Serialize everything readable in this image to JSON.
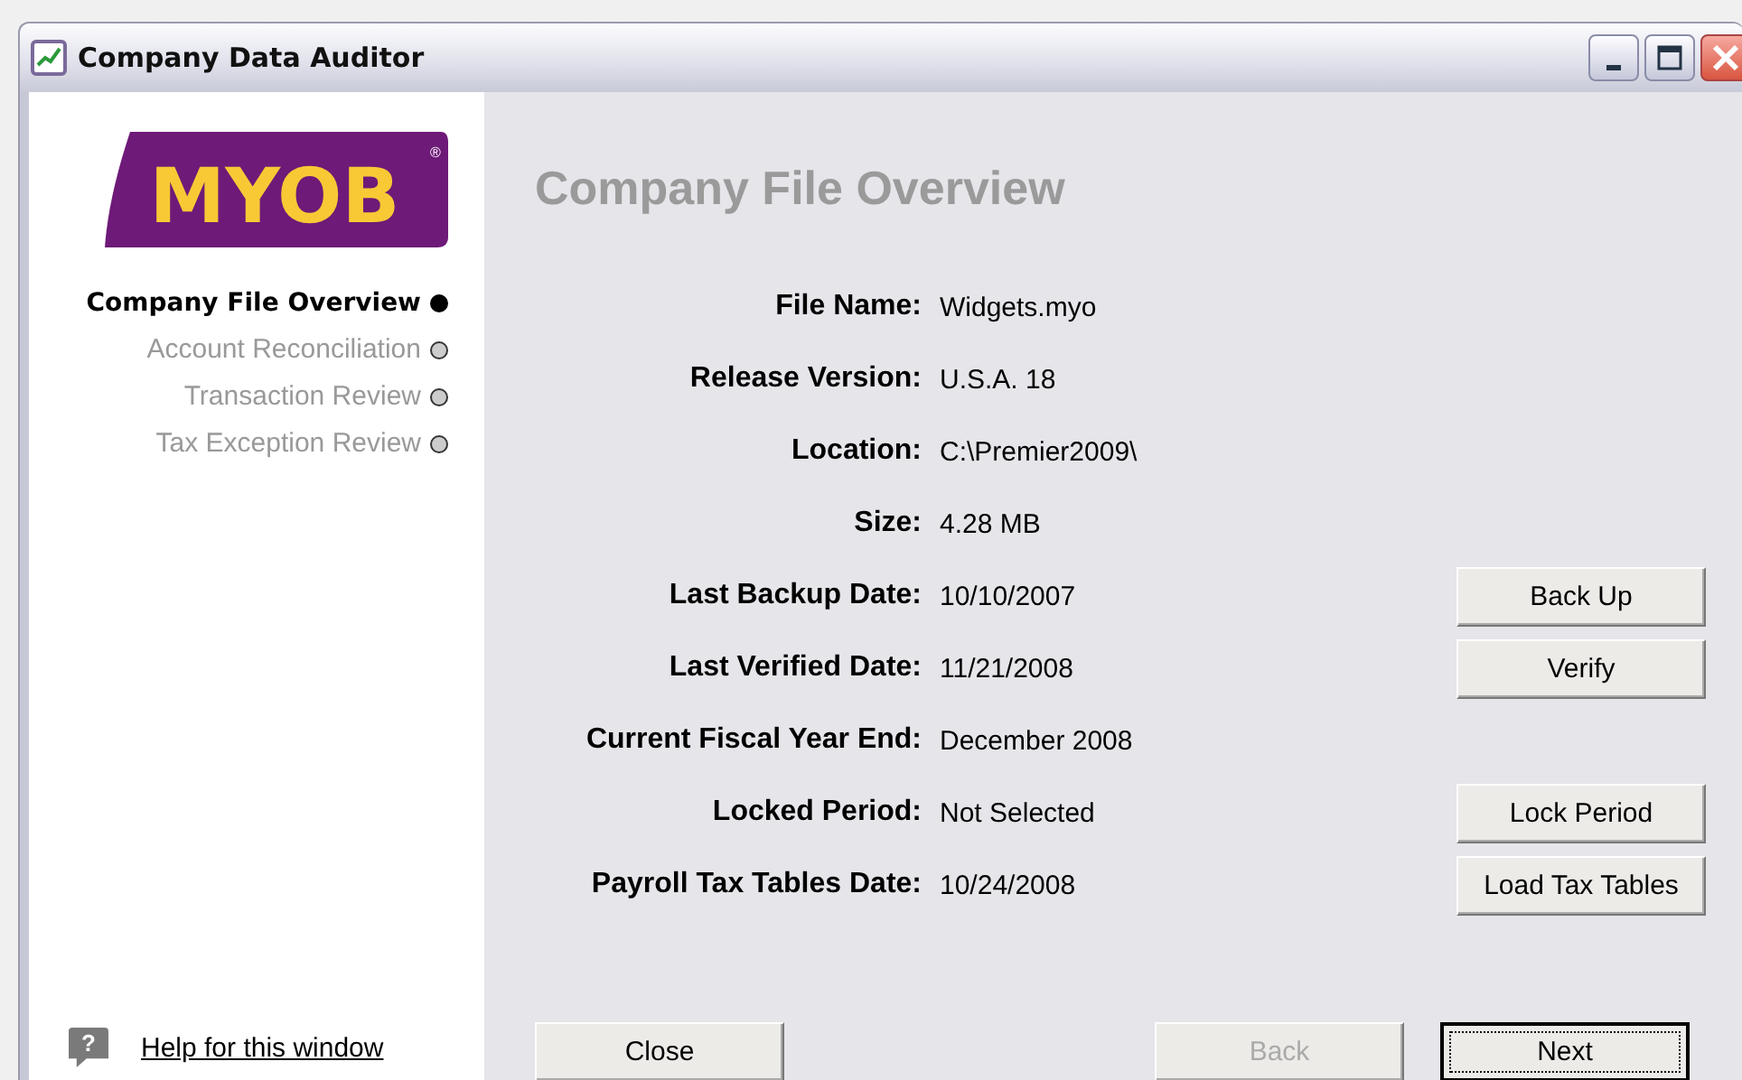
{
  "window": {
    "title": "Company Data Auditor"
  },
  "logo": {
    "text": "MYOB",
    "mark": "®"
  },
  "steps": [
    {
      "label": "Company File Overview",
      "selected": true
    },
    {
      "label": "Account Reconciliation",
      "selected": false
    },
    {
      "label": "Transaction Review",
      "selected": false
    },
    {
      "label": "Tax Exception Review",
      "selected": false
    }
  ],
  "help_link": {
    "icon": "?",
    "label": "Help for this window"
  },
  "page": {
    "heading": "Company File Overview"
  },
  "fields": [
    {
      "label": "File Name:",
      "value": "Widgets.myo"
    },
    {
      "label": "Release Version:",
      "value": "U.S.A. 18"
    },
    {
      "label": "Location:",
      "value": "C:\\Premier2009\\"
    },
    {
      "label": "Size:",
      "value": "4.28 MB"
    },
    {
      "label": "Last Backup Date:",
      "value": "10/10/2007",
      "button": "Back Up"
    },
    {
      "label": "Last Verified Date:",
      "value": "11/21/2008",
      "button": "Verify"
    },
    {
      "label": "Current Fiscal Year End:",
      "value": "December 2008"
    },
    {
      "label": "Locked Period:",
      "value": "Not Selected",
      "button": "Lock Period"
    },
    {
      "label": "Payroll Tax Tables Date:",
      "value": "10/24/2008",
      "button": "Load Tax Tables"
    }
  ],
  "buttons": [
    {
      "label": "Close",
      "disabled": false,
      "default": false
    },
    {
      "label": "Back",
      "disabled": true,
      "default": false
    },
    {
      "label": "Next",
      "disabled": false,
      "default": true
    }
  ]
}
